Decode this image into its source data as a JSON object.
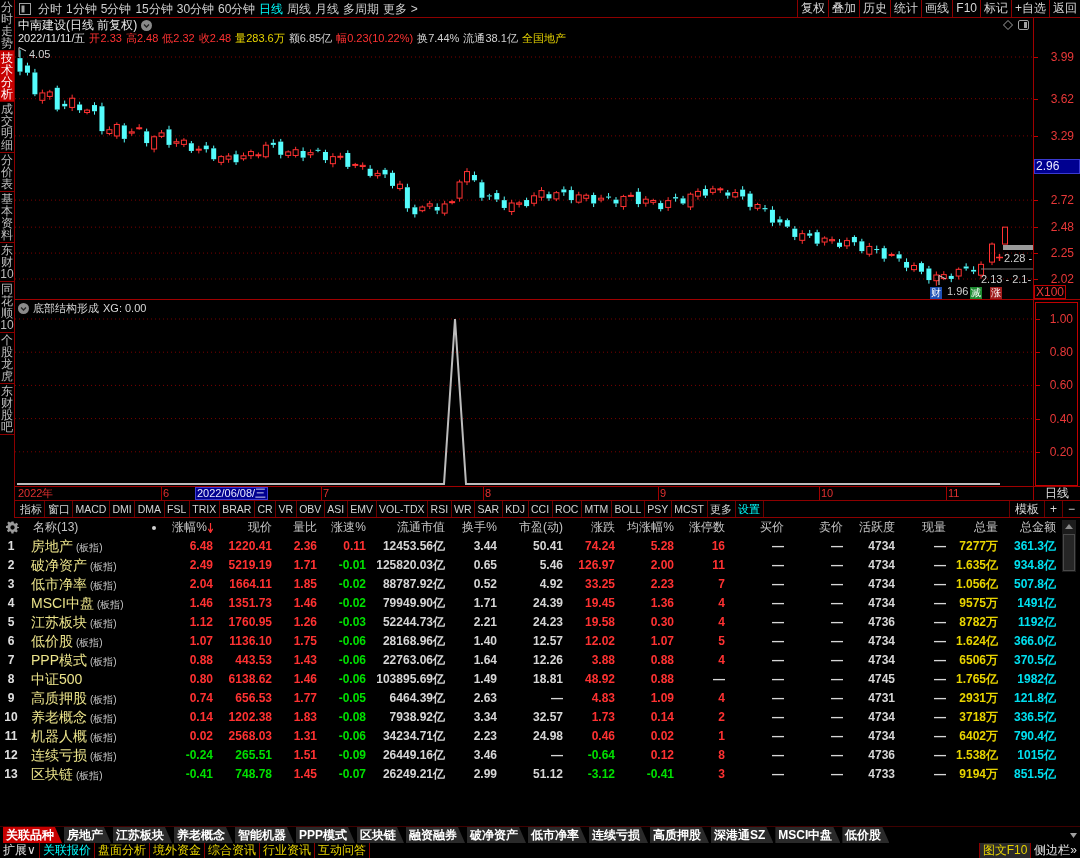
{
  "sidebar": {
    "tabs": [
      {
        "label": "分时走势",
        "selected": false
      },
      {
        "label": "技术分析",
        "selected": true
      },
      {
        "label": "成交明细",
        "selected": false
      },
      {
        "label": "分价表",
        "selected": false
      },
      {
        "label": "基本资料",
        "selected": false
      },
      {
        "label": "东财10",
        "selected": false
      },
      {
        "label": "同花顺10",
        "selected": false
      },
      {
        "label": "个股龙虎",
        "selected": false
      },
      {
        "label": "东财股吧",
        "selected": false
      }
    ]
  },
  "toolbar": {
    "periods": [
      {
        "label": "分时",
        "selected": false
      },
      {
        "label": "1分钟",
        "selected": false
      },
      {
        "label": "5分钟",
        "selected": false
      },
      {
        "label": "15分钟",
        "selected": false
      },
      {
        "label": "30分钟",
        "selected": false
      },
      {
        "label": "60分钟",
        "selected": false
      },
      {
        "label": "日线",
        "selected": true
      },
      {
        "label": "周线",
        "selected": false
      },
      {
        "label": "月线",
        "selected": false
      },
      {
        "label": "多周期",
        "selected": false
      }
    ],
    "more": "更多 >",
    "buttons": [
      "复权",
      "叠加",
      "历史",
      "统计",
      "画线",
      "F10",
      "标记",
      "+自选",
      "返回"
    ]
  },
  "chart": {
    "title": "中南建设(日线 前复权)",
    "info": [
      {
        "text": "2022/11/11/五",
        "kind": "date"
      },
      {
        "text": "开2.33",
        "kind": "up"
      },
      {
        "text": "高2.48",
        "kind": "up"
      },
      {
        "text": "低2.32",
        "kind": "up"
      },
      {
        "text": "收2.48",
        "kind": "up"
      },
      {
        "text": "量283.6万",
        "kind": "volume"
      },
      {
        "text": "额6.85亿",
        "kind": "plain"
      },
      {
        "text": "幅0.23(10.22%)",
        "kind": "up"
      },
      {
        "text": "换7.44%",
        "kind": "plain"
      },
      {
        "text": "流通38.1亿",
        "kind": "plain"
      },
      {
        "text": "全国地产",
        "kind": "sector"
      }
    ],
    "high_label": "4.05",
    "low_label": "1.96",
    "range_labels": [
      "2.28 -",
      "2.13 - 2.1-"
    ],
    "events": [
      {
        "label": "财",
        "color": "#1e50b4"
      },
      {
        "label": "减",
        "color": "#1e8c32"
      },
      {
        "label": "涨",
        "color": "#a01e1e"
      }
    ],
    "price_axis": {
      "ticks": [
        "3.99",
        "3.62",
        "3.29",
        "2.72",
        "2.48",
        "2.25",
        "2.02"
      ],
      "cursor": "2.96",
      "scale": "X100"
    }
  },
  "indicator": {
    "title": "底部结构形成",
    "reading": "XG: 0.00",
    "axis": [
      "1.00",
      "0.80",
      "0.60",
      "0.40",
      "0.20"
    ]
  },
  "date_axis": {
    "year": "2022年",
    "months": [
      "6",
      "7",
      "8",
      "9",
      "10",
      "11"
    ],
    "cursor": "2022/06/08/三",
    "period": "日线"
  },
  "indicator_bar": {
    "tabs": [
      "指标",
      "窗口",
      "MACD",
      "DMI",
      "DMA",
      "FSL",
      "TRIX",
      "BRAR",
      "CR",
      "VR",
      "OBV",
      "ASI",
      "EMV",
      "VOL-TDX",
      "RSI",
      "WR",
      "SAR",
      "KDJ",
      "CCI",
      "ROC",
      "MTM",
      "BOLL",
      "PSY",
      "MCST",
      "更多"
    ],
    "settings": "设置",
    "buttons": [
      "模板",
      "+",
      "−"
    ]
  },
  "table": {
    "name_header": "名称(13)",
    "columns": [
      {
        "label": "涨幅%",
        "kind": "trend",
        "sorted": true
      },
      {
        "label": "现价",
        "kind": "trend",
        "sorted": false
      },
      {
        "label": "量比",
        "kind": "trend",
        "sorted": false
      },
      {
        "label": "涨速%",
        "kind": "trend",
        "sorted": false
      },
      {
        "label": "流通市值",
        "kind": "plain",
        "sorted": false
      },
      {
        "label": "换手%",
        "kind": "plain",
        "sorted": false
      },
      {
        "label": "市盈(动)",
        "kind": "plain",
        "sorted": false
      },
      {
        "label": "涨跌",
        "kind": "trend",
        "sorted": false
      },
      {
        "label": "均涨幅%",
        "kind": "trend",
        "sorted": false
      },
      {
        "label": "涨停数",
        "kind": "trend",
        "sorted": false
      },
      {
        "label": "买价",
        "kind": "plain",
        "sorted": false
      },
      {
        "label": "卖价",
        "kind": "plain",
        "sorted": false
      },
      {
        "label": "活跃度",
        "kind": "plain",
        "sorted": false
      },
      {
        "label": "现量",
        "kind": "plain",
        "sorted": false
      },
      {
        "label": "总量",
        "kind": "volume",
        "sorted": false
      },
      {
        "label": "总金额",
        "kind": "amount",
        "sorted": false
      }
    ],
    "rows": [
      {
        "no": "1",
        "name": "房地产",
        "tag": "(板指)",
        "cells": [
          {
            "value": "6.48",
            "up": true
          },
          {
            "value": "1220.41",
            "up": true
          },
          {
            "value": "2.36",
            "up": true
          },
          {
            "value": "0.11",
            "up": true
          },
          "12453.56亿",
          "3.44",
          "50.41",
          {
            "value": "74.24",
            "up": true
          },
          {
            "value": "5.28",
            "up": true
          },
          {
            "value": "16",
            "up": true
          },
          "—",
          "—",
          "4734",
          "—",
          "7277万",
          "361.3亿"
        ]
      },
      {
        "no": "2",
        "name": "破净资产",
        "tag": "(板指)",
        "cells": [
          {
            "value": "2.49",
            "up": true
          },
          {
            "value": "5219.19",
            "up": true
          },
          {
            "value": "1.71",
            "up": true
          },
          {
            "value": "-0.01",
            "up": false
          },
          "125820.03亿",
          "0.65",
          "5.46",
          {
            "value": "126.97",
            "up": true
          },
          {
            "value": "2.00",
            "up": true
          },
          {
            "value": "11",
            "up": true
          },
          "—",
          "—",
          "4734",
          "—",
          "1.635亿",
          "934.8亿"
        ]
      },
      {
        "no": "3",
        "name": "低市净率",
        "tag": "(板指)",
        "cells": [
          {
            "value": "2.04",
            "up": true
          },
          {
            "value": "1664.11",
            "up": true
          },
          {
            "value": "1.85",
            "up": true
          },
          {
            "value": "-0.02",
            "up": false
          },
          "88787.92亿",
          "0.52",
          "4.92",
          {
            "value": "33.25",
            "up": true
          },
          {
            "value": "2.23",
            "up": true
          },
          {
            "value": "7",
            "up": true
          },
          "—",
          "—",
          "4734",
          "—",
          "1.056亿",
          "507.8亿"
        ]
      },
      {
        "no": "4",
        "name": "MSCI中盘",
        "tag": "(板指)",
        "cells": [
          {
            "value": "1.46",
            "up": true
          },
          {
            "value": "1351.73",
            "up": true
          },
          {
            "value": "1.46",
            "up": true
          },
          {
            "value": "-0.02",
            "up": false
          },
          "79949.90亿",
          "1.71",
          "24.39",
          {
            "value": "19.45",
            "up": true
          },
          {
            "value": "1.36",
            "up": true
          },
          {
            "value": "4",
            "up": true
          },
          "—",
          "—",
          "4734",
          "—",
          "9575万",
          "1491亿"
        ]
      },
      {
        "no": "5",
        "name": "江苏板块",
        "tag": "(板指)",
        "cells": [
          {
            "value": "1.12",
            "up": true
          },
          {
            "value": "1760.95",
            "up": true
          },
          {
            "value": "1.26",
            "up": true
          },
          {
            "value": "-0.03",
            "up": false
          },
          "52244.73亿",
          "2.21",
          "24.23",
          {
            "value": "19.58",
            "up": true
          },
          {
            "value": "0.30",
            "up": true
          },
          {
            "value": "4",
            "up": true
          },
          "—",
          "—",
          "4736",
          "—",
          "8782万",
          "1192亿"
        ]
      },
      {
        "no": "6",
        "name": "低价股",
        "tag": "(板指)",
        "cells": [
          {
            "value": "1.07",
            "up": true
          },
          {
            "value": "1136.10",
            "up": true
          },
          {
            "value": "1.75",
            "up": true
          },
          {
            "value": "-0.06",
            "up": false
          },
          "28168.96亿",
          "1.40",
          "12.57",
          {
            "value": "12.02",
            "up": true
          },
          {
            "value": "1.07",
            "up": true
          },
          {
            "value": "5",
            "up": true
          },
          "—",
          "—",
          "4734",
          "—",
          "1.624亿",
          "366.0亿"
        ]
      },
      {
        "no": "7",
        "name": "PPP模式",
        "tag": "(板指)",
        "cells": [
          {
            "value": "0.88",
            "up": true
          },
          {
            "value": "443.53",
            "up": true
          },
          {
            "value": "1.43",
            "up": true
          },
          {
            "value": "-0.06",
            "up": false
          },
          "22763.06亿",
          "1.64",
          "12.26",
          {
            "value": "3.88",
            "up": true
          },
          {
            "value": "0.88",
            "up": true
          },
          {
            "value": "4",
            "up": true
          },
          "—",
          "—",
          "4734",
          "—",
          "6506万",
          "370.5亿"
        ]
      },
      {
        "no": "8",
        "name": "中证500",
        "cells": [
          {
            "value": "0.80",
            "up": true
          },
          {
            "value": "6138.62",
            "up": true
          },
          {
            "value": "1.46",
            "up": true
          },
          {
            "value": "-0.06",
            "up": false
          },
          "103895.69亿",
          "1.49",
          "18.81",
          {
            "value": "48.92",
            "up": true
          },
          {
            "value": "0.88",
            "up": true
          },
          "—",
          "—",
          "—",
          "4745",
          "—",
          "1.765亿",
          "1982亿"
        ]
      },
      {
        "no": "9",
        "name": "高质押股",
        "tag": "(板指)",
        "cells": [
          {
            "value": "0.74",
            "up": true
          },
          {
            "value": "656.53",
            "up": true
          },
          {
            "value": "1.77",
            "up": true
          },
          {
            "value": "-0.05",
            "up": false
          },
          "6464.39亿",
          "2.63",
          "—",
          {
            "value": "4.83",
            "up": true
          },
          {
            "value": "1.09",
            "up": true
          },
          {
            "value": "4",
            "up": true
          },
          "—",
          "—",
          "4731",
          "—",
          "2931万",
          "121.8亿"
        ]
      },
      {
        "no": "10",
        "name": "养老概念",
        "tag": "(板指)",
        "cells": [
          {
            "value": "0.14",
            "up": true
          },
          {
            "value": "1202.38",
            "up": true
          },
          {
            "value": "1.83",
            "up": true
          },
          {
            "value": "-0.08",
            "up": false
          },
          "7938.92亿",
          "3.34",
          "32.57",
          {
            "value": "1.73",
            "up": true
          },
          {
            "value": "0.14",
            "up": true
          },
          {
            "value": "2",
            "up": true
          },
          "—",
          "—",
          "4734",
          "—",
          "3718万",
          "336.5亿"
        ]
      },
      {
        "no": "11",
        "name": "机器人概",
        "tag": "(板指)",
        "cells": [
          {
            "value": "0.02",
            "up": true
          },
          {
            "value": "2568.03",
            "up": true
          },
          {
            "value": "1.31",
            "up": true
          },
          {
            "value": "-0.06",
            "up": false
          },
          "34234.71亿",
          "2.23",
          "24.98",
          {
            "value": "0.46",
            "up": true
          },
          {
            "value": "0.02",
            "up": true
          },
          {
            "value": "1",
            "up": true
          },
          "—",
          "—",
          "4734",
          "—",
          "6402万",
          "790.4亿"
        ]
      },
      {
        "no": "12",
        "name": "连续亏损",
        "tag": "(板指)",
        "cells": [
          {
            "value": "-0.24",
            "up": false
          },
          {
            "value": "265.51",
            "up": false
          },
          {
            "value": "1.51",
            "up": true
          },
          {
            "value": "-0.09",
            "up": false
          },
          "26449.16亿",
          "3.46",
          "—",
          {
            "value": "-0.64",
            "up": false
          },
          {
            "value": "0.12",
            "up": true
          },
          {
            "value": "8",
            "up": true
          },
          "—",
          "—",
          "4736",
          "—",
          "1.538亿",
          "1015亿"
        ]
      },
      {
        "no": "13",
        "name": "区块链",
        "tag": "(板指)",
        "cells": [
          {
            "value": "-0.41",
            "up": false
          },
          {
            "value": "748.78",
            "up": false
          },
          {
            "value": "1.45",
            "up": true
          },
          {
            "value": "-0.07",
            "up": false
          },
          "26249.21亿",
          "2.99",
          "51.12",
          {
            "value": "-3.12",
            "up": false
          },
          {
            "value": "-0.41",
            "up": false
          },
          {
            "value": "3",
            "up": true
          },
          "—",
          "—",
          "4733",
          "—",
          "9194万",
          "851.5亿"
        ]
      }
    ]
  },
  "related_tabs": [
    {
      "label": "关联品种",
      "selected": true
    },
    {
      "label": "房地产",
      "selected": false
    },
    {
      "label": "江苏板块",
      "selected": false
    },
    {
      "label": "养老概念",
      "selected": false
    },
    {
      "label": "智能机器",
      "selected": false
    },
    {
      "label": "PPP模式",
      "selected": false
    },
    {
      "label": "区块链",
      "selected": false
    },
    {
      "label": "融资融券",
      "selected": false
    },
    {
      "label": "破净资产",
      "selected": false
    },
    {
      "label": "低市净率",
      "selected": false
    },
    {
      "label": "连续亏损",
      "selected": false
    },
    {
      "label": "高质押股",
      "selected": false
    },
    {
      "label": "深港通SZ",
      "selected": false
    },
    {
      "label": "MSCI中盘",
      "selected": false
    },
    {
      "label": "低价股",
      "selected": false
    }
  ],
  "status_bar": {
    "expand": "扩展∨",
    "tabs": [
      {
        "label": "关联报价",
        "selected": true
      },
      {
        "label": "盘面分析",
        "selected": false
      },
      {
        "label": "境外资金",
        "selected": false
      },
      {
        "label": "综合资讯",
        "selected": false
      },
      {
        "label": "行业资讯",
        "selected": false
      },
      {
        "label": "互动问答",
        "selected": false
      }
    ],
    "right": [
      "图文F10",
      "侧边栏»"
    ]
  }
}
